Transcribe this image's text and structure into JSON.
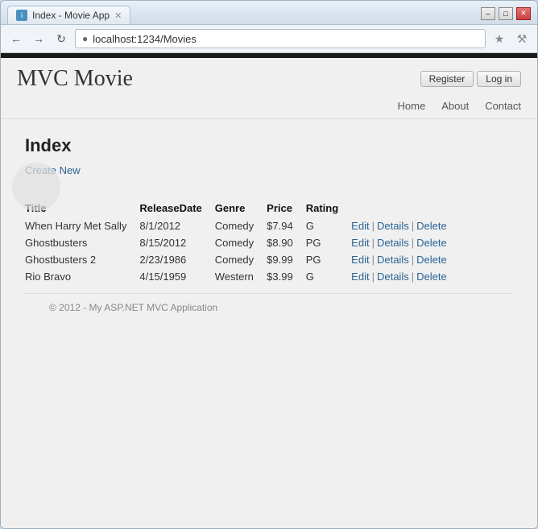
{
  "browser": {
    "tab_title": "Index - Movie App",
    "url": "localhost:1234/Movies",
    "window_controls": {
      "minimize": "–",
      "maximize": "□",
      "close": "✕"
    }
  },
  "nav": {
    "back": "←",
    "forward": "→",
    "refresh": "↻",
    "address_icon": "🔒",
    "address": "localhost:1234/Movies",
    "star_icon": "☆",
    "tools_icon": "🔧"
  },
  "app": {
    "title": "MVC Movie",
    "header_buttons": {
      "register": "Register",
      "login": "Log in"
    },
    "nav_links": [
      "Home",
      "About",
      "Contact"
    ]
  },
  "page": {
    "title": "Index",
    "create_new_label": "Create New",
    "table": {
      "headers": [
        "Title",
        "ReleaseDate",
        "Genre",
        "Price",
        "Rating",
        ""
      ],
      "rows": [
        {
          "title": "When Harry Met Sally",
          "release_date": "8/1/2012",
          "genre": "Comedy",
          "price": "$7.94",
          "rating": "G"
        },
        {
          "title": "Ghostbusters",
          "release_date": "8/15/2012",
          "genre": "Comedy",
          "price": "$8.90",
          "rating": "PG"
        },
        {
          "title": "Ghostbusters 2",
          "release_date": "2/23/1986",
          "genre": "Comedy",
          "price": "$9.99",
          "rating": "PG"
        },
        {
          "title": "Rio Bravo",
          "release_date": "4/15/1959",
          "genre": "Western",
          "price": "$3.99",
          "rating": "G"
        }
      ],
      "actions": [
        "Edit",
        "Details",
        "Delete"
      ]
    }
  },
  "footer": {
    "text": "© 2012 - My ASP.NET MVC Application"
  }
}
